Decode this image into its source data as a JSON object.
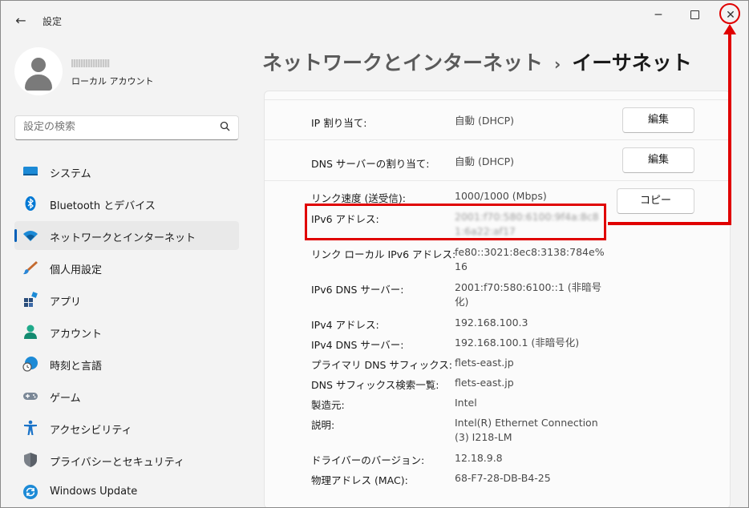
{
  "window": {
    "title": "設定",
    "back_icon": "back-arrow-icon",
    "controls": {
      "minimize": "─",
      "close": "✕"
    }
  },
  "account": {
    "type": "ローカル アカウント"
  },
  "search": {
    "placeholder": "設定の検索",
    "icon": "🔍"
  },
  "sidebar": {
    "items": [
      {
        "label": "システム",
        "icon": "system-icon"
      },
      {
        "label": "Bluetooth とデバイス",
        "icon": "bluetooth-icon"
      },
      {
        "label": "ネットワークとインターネット",
        "icon": "wifi-icon",
        "selected": true
      },
      {
        "label": "個人用設定",
        "icon": "brush-icon"
      },
      {
        "label": "アプリ",
        "icon": "apps-icon"
      },
      {
        "label": "アカウント",
        "icon": "account-icon"
      },
      {
        "label": "時刻と言語",
        "icon": "clock-globe-icon"
      },
      {
        "label": "ゲーム",
        "icon": "gamepad-icon"
      },
      {
        "label": "アクセシビリティ",
        "icon": "accessibility-icon"
      },
      {
        "label": "プライバシーとセキュリティ",
        "icon": "shield-icon"
      },
      {
        "label": "Windows Update",
        "icon": "update-icon"
      }
    ]
  },
  "header": {
    "parent": "ネットワークとインターネット",
    "separator": "›",
    "current": "イーサネット"
  },
  "settings": {
    "ip_assignment": {
      "label": "IP 割り当て:",
      "value": "自動 (DHCP)",
      "button": "編集"
    },
    "dns_assignment": {
      "label": "DNS サーバーの割り当て:",
      "value": "自動 (DHCP)",
      "button": "編集"
    },
    "copy_button": "コピー",
    "properties": [
      {
        "label": "リンク速度 (送受信):",
        "value": "1000/1000 (Mbps)"
      },
      {
        "label": "IPv6 アドレス:",
        "value": "2001:f70:580:6100:9f4a:8c81:6a22:af17"
      },
      {
        "label": "リンク ローカル IPv6 アドレス:",
        "value": "fe80::3021:8ec8:3138:784e%16"
      },
      {
        "label": "IPv6 DNS サーバー:",
        "value": "2001:f70:580:6100::1 (非暗号化)"
      },
      {
        "label": "IPv4 アドレス:",
        "value": "192.168.100.3"
      },
      {
        "label": "IPv4 DNS サーバー:",
        "value": "192.168.100.1 (非暗号化)"
      },
      {
        "label": "プライマリ DNS サフィックス:",
        "value": "flets-east.jp"
      },
      {
        "label": "DNS サフィックス検索一覧:",
        "value": "flets-east.jp"
      },
      {
        "label": "製造元:",
        "value": "Intel"
      },
      {
        "label": "説明:",
        "value": "Intel(R) Ethernet Connection (3) I218-LM"
      },
      {
        "label": "ドライバーのバージョン:",
        "value": "12.18.9.8"
      },
      {
        "label": "物理アドレス (MAC):",
        "value": "68-F7-28-DB-B4-25"
      }
    ]
  },
  "colors": {
    "accent": "#005fb8",
    "annotation": "#e00000"
  }
}
